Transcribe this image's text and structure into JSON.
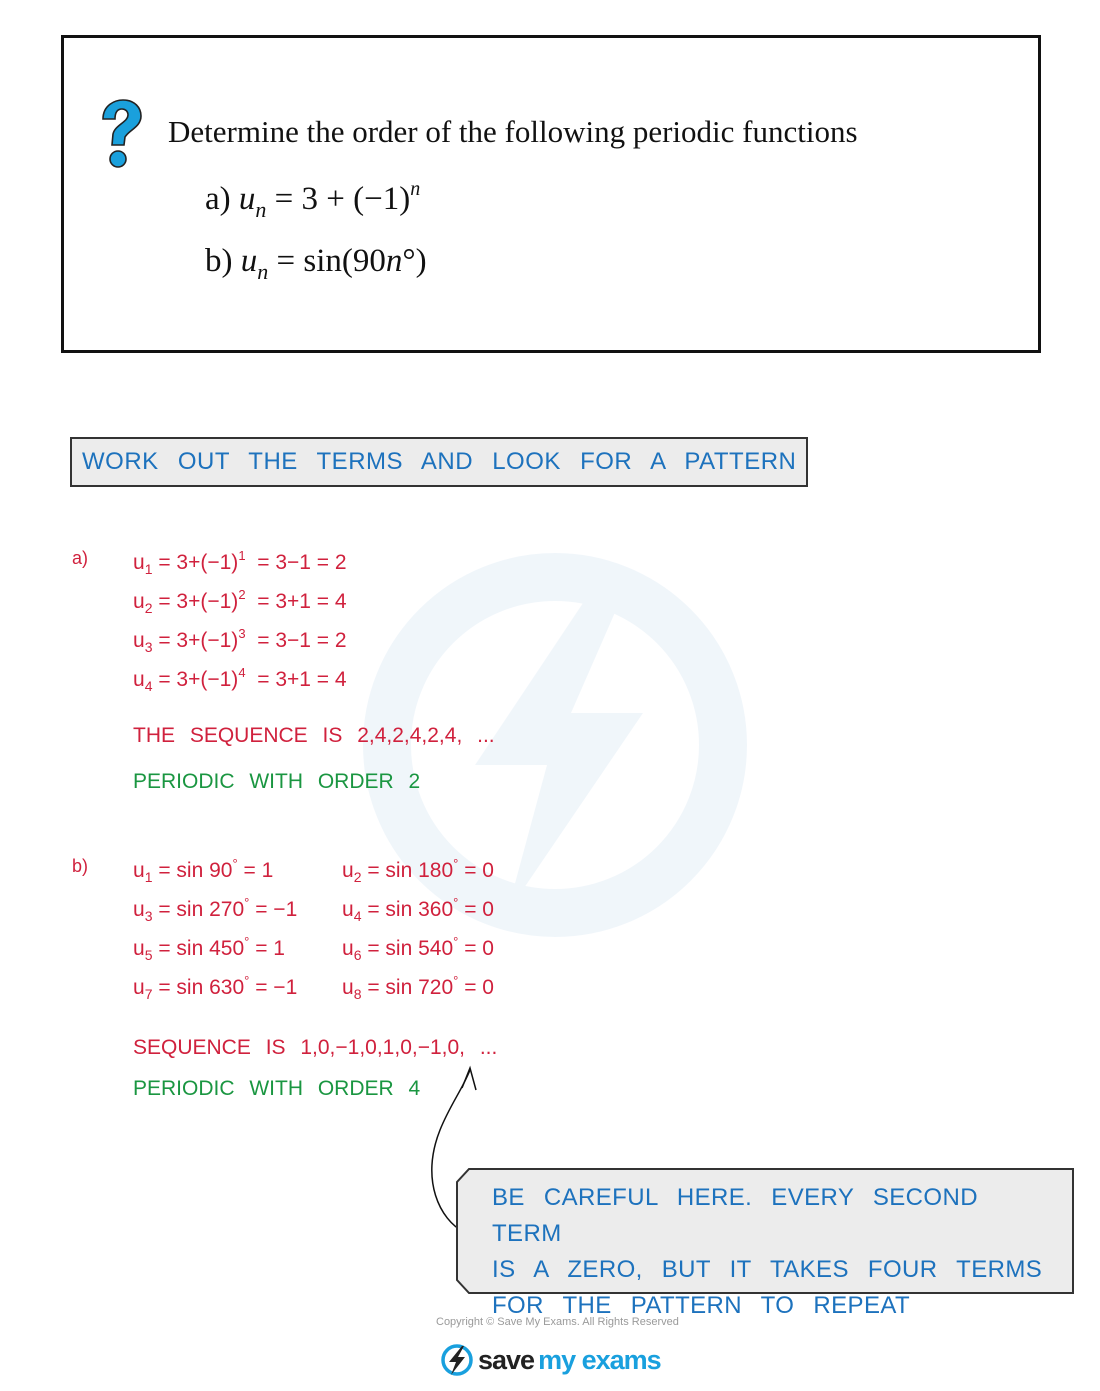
{
  "question": {
    "icon": "question-mark-icon",
    "prompt": "Determine the order of the following periodic functions",
    "part_a": {
      "label": "a)",
      "var": "u",
      "sub": "n",
      "rhs": "= 3 + (−1)",
      "exp": "n"
    },
    "part_b": {
      "label": "b)",
      "var": "u",
      "sub": "n",
      "rhs_pre": "= sin(90",
      "rhs_var": "n",
      "rhs_post": "°)"
    }
  },
  "hint": "WORK OUT THE TERMS AND LOOK FOR A PATTERN",
  "solution_a": {
    "label": "a)",
    "rows": [
      {
        "sub": "1",
        "pre": "= 3+(−1)",
        "exp": "1",
        "post": "= 3−1 = 2"
      },
      {
        "sub": "2",
        "pre": "= 3+(−1)",
        "exp": "2",
        "post": "= 3+1 = 4"
      },
      {
        "sub": "3",
        "pre": "= 3+(−1)",
        "exp": "3",
        "post": "= 3−1 = 2"
      },
      {
        "sub": "4",
        "pre": "= 3+(−1)",
        "exp": "4",
        "post": "= 3+1 = 4"
      }
    ],
    "sequence": "THE SEQUENCE IS 2,4,2,4,2,4, ...",
    "conclusion": "PERIODIC WITH ORDER 2"
  },
  "solution_b": {
    "label": "b)",
    "rows": [
      {
        "sub": "1",
        "pre": "= sin 90",
        "post": "= 1"
      },
      {
        "sub": "2",
        "pre": "= sin 180",
        "post": "= 0"
      },
      {
        "sub": "3",
        "pre": "= sin 270",
        "post": "= −1"
      },
      {
        "sub": "4",
        "pre": "= sin 360",
        "post": "= 0"
      },
      {
        "sub": "5",
        "pre": "= sin 450",
        "post": "= 1"
      },
      {
        "sub": "6",
        "pre": "= sin 540",
        "post": "= 0"
      },
      {
        "sub": "7",
        "pre": "= sin 630",
        "post": "= −1"
      },
      {
        "sub": "8",
        "pre": "= sin 720",
        "post": "= 0"
      }
    ],
    "degree": "°",
    "sequence": "SEQUENCE IS 1,0,−1,0,1,0,−1,0, ...",
    "conclusion": "PERIODIC WITH ORDER 4"
  },
  "callout": {
    "lines": [
      "BE CAREFUL HERE. EVERY SECOND TERM",
      "IS A ZERO, BUT IT TAKES FOUR TERMS",
      "FOR THE PATTERN TO REPEAT"
    ]
  },
  "footer": {
    "copyright": "Copyright © Save My Exams. All Rights Reserved",
    "logo_save": "save",
    "logo_my": "my exams"
  },
  "colors": {
    "red": "#d0213d",
    "green": "#1a9641",
    "blue": "#1d72bd",
    "brand": "#19a0de"
  }
}
